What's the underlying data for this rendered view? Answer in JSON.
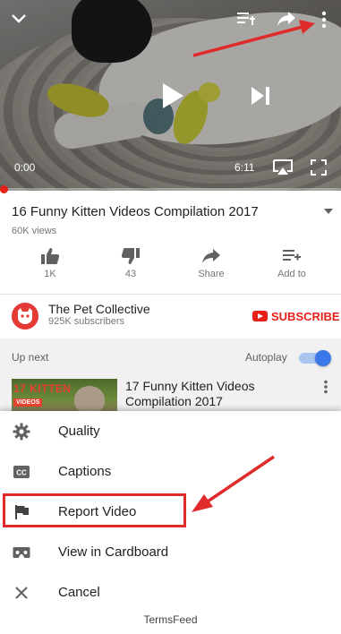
{
  "player": {
    "current_time": "0:00",
    "duration": "6:11",
    "progress_fraction": 0.01,
    "icons": [
      "chevron-down-icon",
      "add-to-queue-icon",
      "share-icon",
      "more-vert-icon",
      "play-icon",
      "skip-next-icon",
      "cast-icon",
      "fullscreen-icon"
    ]
  },
  "video": {
    "title": "16 Funny Kitten Videos Compilation 2017",
    "views": "60K views"
  },
  "actions": {
    "like_count": "1K",
    "dislike_count": "43",
    "share_label": "Share",
    "add_label": "Add to"
  },
  "channel": {
    "name": "The Pet Collective",
    "subscribers": "925K subscribers",
    "subscribe_label": "SUBSCRIBE"
  },
  "up_next": {
    "label": "Up next",
    "autoplay_label": "Autoplay",
    "autoplay_on": true,
    "next_video_title": "17 Funny Kitten Videos Compilation 2017",
    "thumb_text_big": "17 KITTEN",
    "thumb_text_small": "VIDEOS"
  },
  "menu": {
    "items": [
      {
        "label": "Quality",
        "icon": "gear-icon"
      },
      {
        "label": "Captions",
        "icon": "captions-icon"
      },
      {
        "label": "Report Video",
        "icon": "flag-icon"
      },
      {
        "label": "View in Cardboard",
        "icon": "cardboard-icon"
      },
      {
        "label": "Cancel",
        "icon": "close-icon"
      }
    ]
  },
  "footer": {
    "brand": "TermsFeed"
  },
  "colors": {
    "accent_red": "#e62117",
    "annotation_red": "#e02b2b",
    "toggle_blue": "#3b78e7"
  }
}
